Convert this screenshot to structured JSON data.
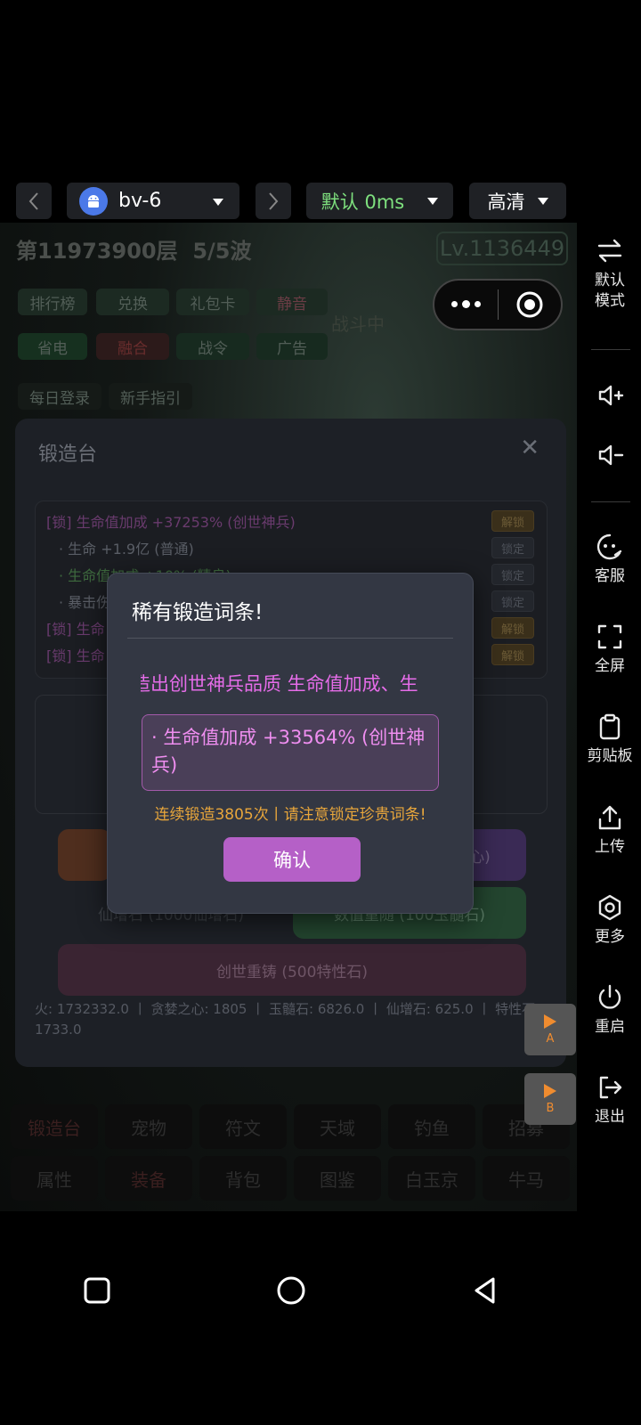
{
  "toolbar": {
    "device_name": "bv-6",
    "latency_label": "默认 0ms",
    "quality_label": "高清"
  },
  "game": {
    "floor": "第11973900层",
    "wave": "5/5波",
    "level": "Lv.1136449",
    "status_text": "战斗中",
    "buttons_row1": [
      "排行榜",
      "兑换",
      "礼包卡",
      "静音"
    ],
    "buttons_row2": [
      "省电",
      "融合",
      "战令",
      "广告"
    ],
    "buttons_row3": [
      "每日登录",
      "新手指引"
    ]
  },
  "forge": {
    "title": "锻造台",
    "close_symbol": "✕",
    "attributes": [
      {
        "text": "[锁] 生命值加成 +37253% (创世神兵)",
        "btn": "解锁",
        "color": "#6a3b6e",
        "indent": false
      },
      {
        "text": "· 生命 +1.9亿 (普通)",
        "btn": "锁定",
        "color": "#5a5e66",
        "indent": true
      },
      {
        "text": "· 生命值加成 +10% (精良)",
        "btn": "锁定",
        "color": "#3e6a3e",
        "indent": true
      },
      {
        "text": "· 暴击伤害",
        "btn": "锁定",
        "color": "#5a5e66",
        "indent": true
      },
      {
        "text": "[锁] 生命",
        "btn": "解锁",
        "color": "#6a3b6e",
        "indent": false
      },
      {
        "text": "[锁] 生命",
        "btn": "解锁",
        "color": "#6a3b6e",
        "indent": false
      }
    ],
    "btn_partial_right": "心)",
    "btn_xianzeng": "仙增石 (1000仙增石)",
    "btn_shuzhi": "数值重随 (100玉髓石)",
    "btn_chuangshi": "创世重铸 (500特性石)",
    "stats_line": "火: 1732332.0 丨 贪婪之心: 1805 丨 玉髓石: 6826.0 丨 仙增石: 625.0 丨 特性石: 1733.0"
  },
  "bottom_tabs": {
    "row1": [
      "锻造台",
      "宠物",
      "符文",
      "天域",
      "钓鱼",
      "招募"
    ],
    "row2": [
      "属性",
      "装备",
      "背包",
      "图鉴",
      "白玉京",
      "牛马"
    ]
  },
  "modal": {
    "title": "稀有锻造词条!",
    "marquee": "造出创世神兵品质 生命值加成、生",
    "result": "· 生命值加成 +33564% (创世神兵)",
    "notice": "连续锻造3805次丨请注意锁定珍贵词条!",
    "confirm": "确认"
  },
  "ab_keys": {
    "a": "A",
    "b": "B"
  },
  "sidebar": {
    "mode_line1": "默认",
    "mode_line2": "模式",
    "service": "客服",
    "fullscreen": "全屏",
    "clipboard": "剪贴板",
    "upload": "上传",
    "more": "更多",
    "restart": "重启",
    "exit": "退出"
  }
}
